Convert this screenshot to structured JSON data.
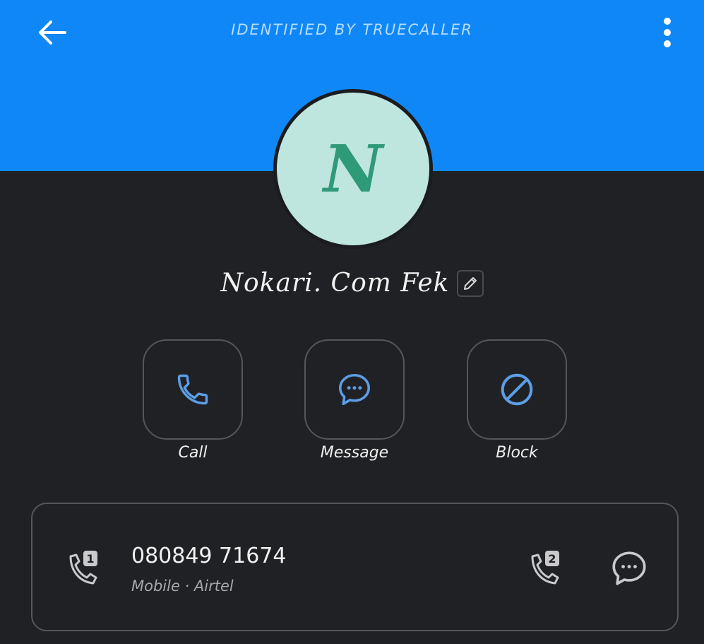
{
  "header": {
    "title": "IDENTIFIED BY TRUECALLER",
    "back_icon": "arrow-left-icon",
    "menu_icon": "more-vertical-icon",
    "background_color": "#0f87f7"
  },
  "contact": {
    "avatar_letter": "N",
    "name": "Nokari. Com Fek",
    "edit_icon": "pencil-icon"
  },
  "actions": [
    {
      "label": "Call",
      "icon": "phone-icon"
    },
    {
      "label": "Message",
      "icon": "chat-bubble-icon"
    },
    {
      "label": "Block",
      "icon": "block-icon"
    }
  ],
  "number_card": {
    "number": "080849 71674",
    "meta": "Mobile · Airtel",
    "sim1_icon": "phone-sim-1-icon",
    "sim1_badge": "1",
    "sim2_icon": "phone-sim-2-icon",
    "sim2_badge": "2",
    "message_icon": "chat-bubble-icon"
  },
  "colors": {
    "accent": "#5b9ee6",
    "background": "#202124"
  }
}
